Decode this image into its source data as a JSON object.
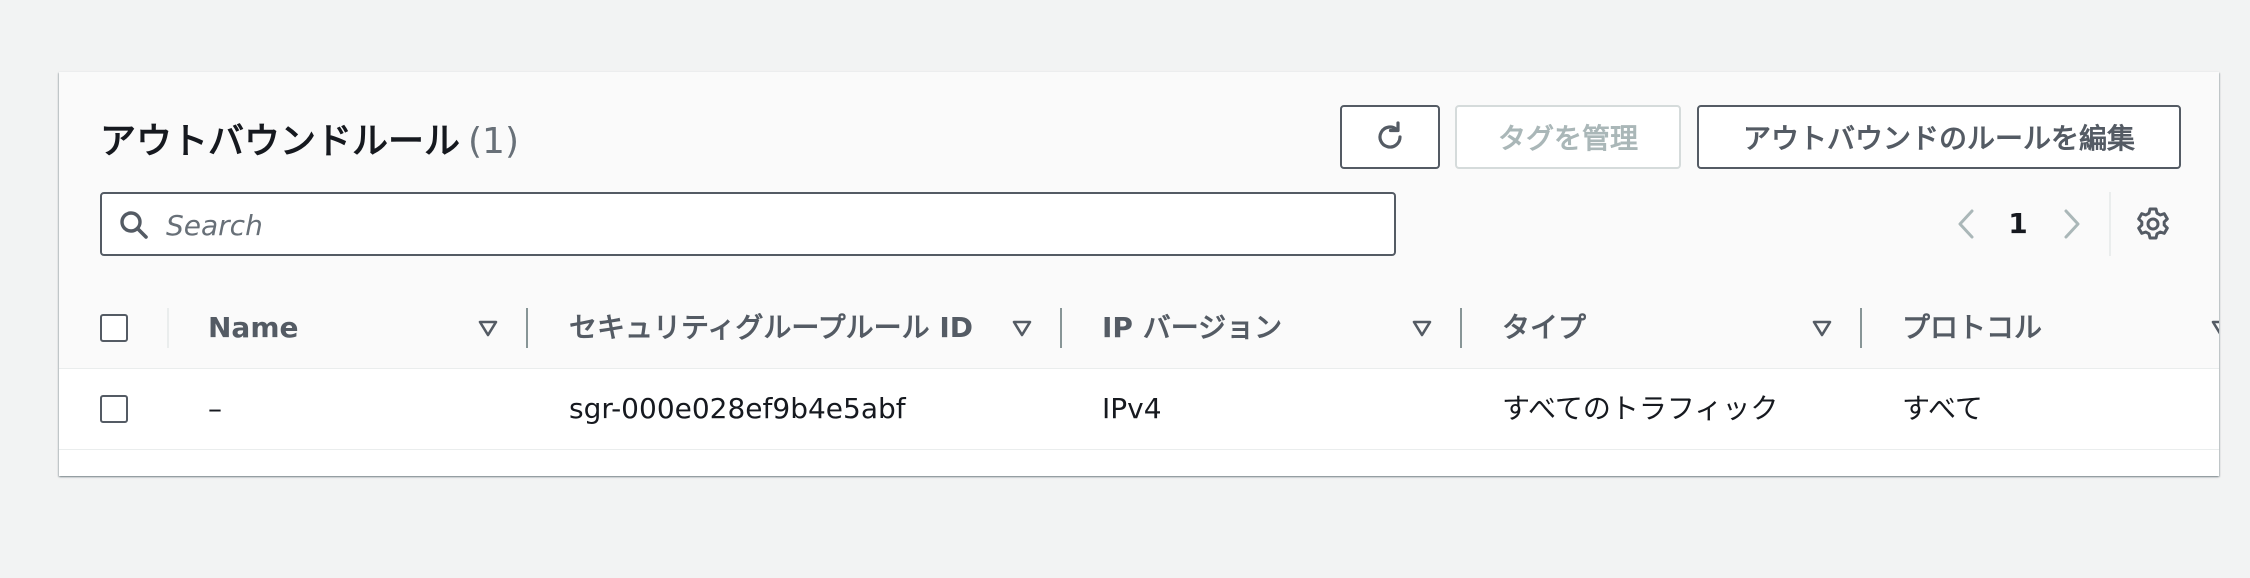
{
  "panel": {
    "title": "アウトバウンドルール",
    "count": "(1)"
  },
  "toolbar": {
    "refresh_icon": "refresh-icon",
    "manage_tags_label": "タグを管理",
    "edit_outbound_label": "アウトバウンドのルールを編集"
  },
  "search": {
    "placeholder": "Search",
    "value": ""
  },
  "pagination": {
    "current_page": "1"
  },
  "table": {
    "columns": [
      {
        "label": "Name"
      },
      {
        "label": "セキュリティグループルール ID"
      },
      {
        "label": "IP バージョン"
      },
      {
        "label": "タイプ"
      },
      {
        "label": "プロトコル"
      }
    ],
    "rows": [
      {
        "name": "–",
        "rule_id": "sgr-000e028ef9b4e5abf",
        "ip_version": "IPv4",
        "type": "すべてのトラフィック",
        "protocol": "すべて"
      }
    ]
  },
  "colors": {
    "background": "#f2f3f3",
    "text": "#16191f",
    "muted": "#545b64",
    "disabled": "#aab7b8"
  }
}
